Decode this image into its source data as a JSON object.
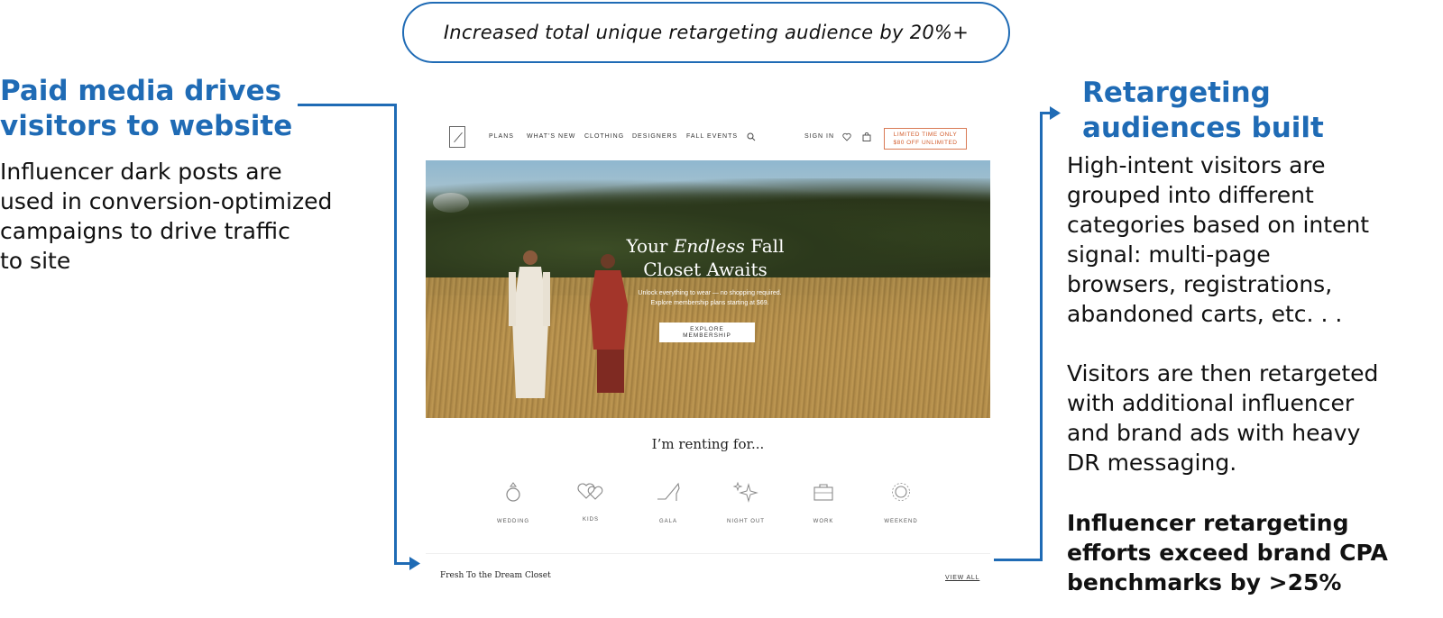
{
  "banner": {
    "text": "Increased total unique retargeting audience by 20%+"
  },
  "left": {
    "heading_line1": "Paid media drives",
    "heading_line2": "visitors to website",
    "body_lines": [
      "Influencer dark posts are",
      "used in conversion-optimized",
      "campaigns to drive traffic",
      "to site"
    ]
  },
  "right": {
    "heading_line1": "Retargeting",
    "heading_line2": "audiences built",
    "para1_lines": [
      "High-intent visitors are",
      "grouped into different",
      "categories based on intent",
      "signal: multi-page",
      "browsers, registrations,",
      "abandoned carts, etc. . ."
    ],
    "para2_lines": [
      "Visitors are then retargeted",
      "with additional influencer",
      "and brand ads with heavy",
      "DR messaging."
    ],
    "bold_lines": [
      "Influencer retargeting",
      "efforts exceed brand CPA",
      "benchmarks by >25%"
    ]
  },
  "site": {
    "nav": [
      "PLANS",
      "WHAT'S NEW",
      "CLOTHING",
      "DESIGNERS",
      "FALL EVENTS"
    ],
    "sign_in": "SIGN IN",
    "promo_line1": "LIMITED TIME ONLY",
    "promo_line2": "$80 OFF UNLIMITED",
    "hero_title_pre": "Your ",
    "hero_title_em": "Endless",
    "hero_title_post": " Fall",
    "hero_title_line2": "Closet Awaits",
    "hero_sub1": "Unlock everything to wear — no shopping required.",
    "hero_sub2": "Explore membership plans starting at $69.",
    "hero_button": "EXPLORE MEMBERSHIP",
    "renting": "I’m renting for...",
    "categories": [
      "WEDDING",
      "KIDS",
      "GALA",
      "NIGHT OUT",
      "WORK",
      "WEEKEND"
    ],
    "footer_left": "Fresh To the Dream Closet",
    "footer_right": "VIEW ALL"
  },
  "colors": {
    "accent": "#1f6bb5",
    "promo": "#d25c2c"
  }
}
